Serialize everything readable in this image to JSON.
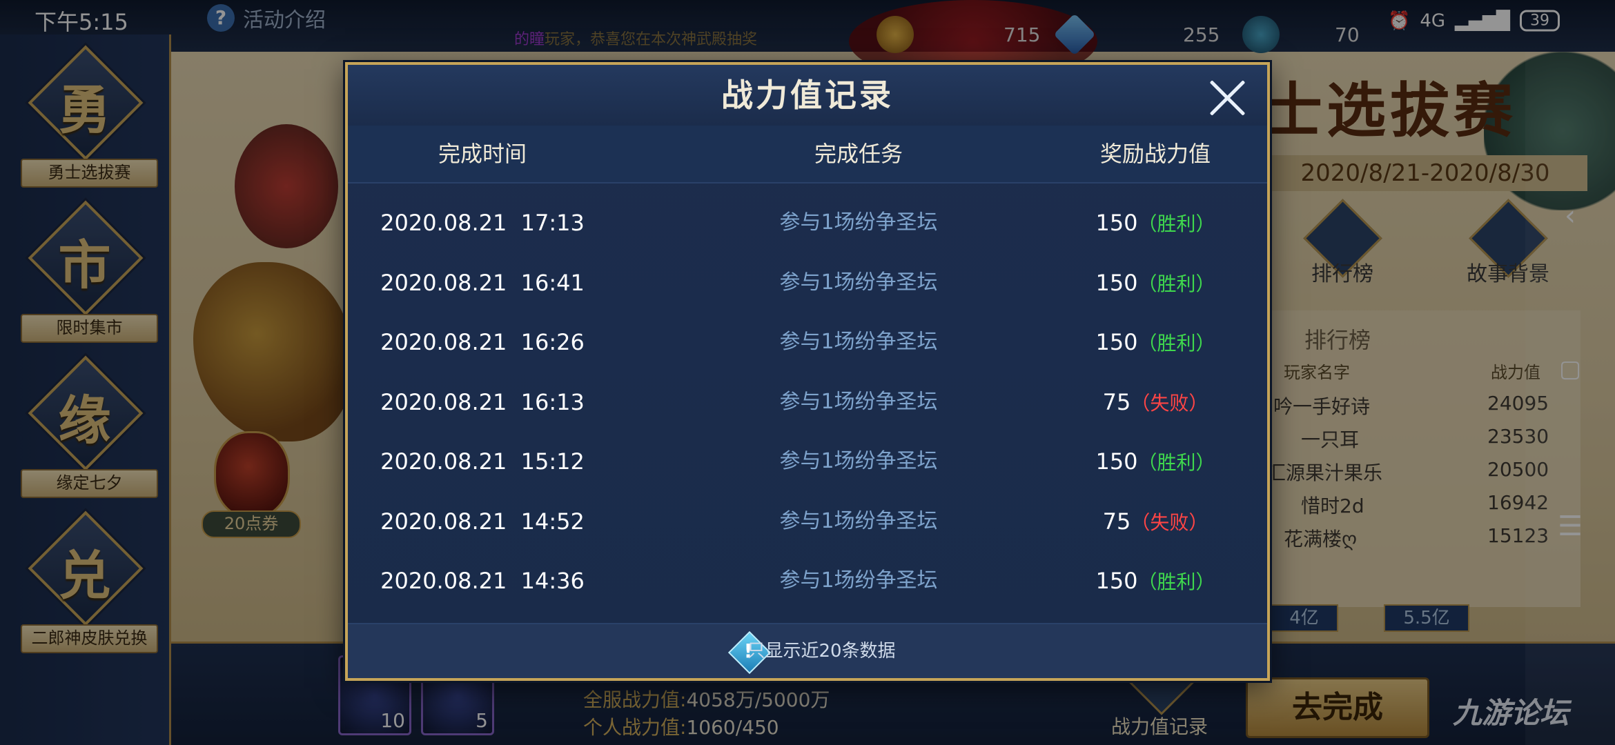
{
  "status_bar": {
    "time": "下午5:15",
    "network": "4G",
    "battery": "39"
  },
  "top_bar": {
    "activity_label": "活动介绍",
    "marquee_highlight": "的瞳",
    "marquee_text": "玩家，恭喜您在本次神武殿抽奖",
    "currencies": [
      {
        "icon": "coin-icon",
        "value": "715"
      },
      {
        "icon": "diamond-icon",
        "value": "255"
      },
      {
        "icon": "token-icon",
        "value": "70"
      }
    ]
  },
  "sidebar": {
    "items": [
      {
        "glyph": "勇",
        "label": "勇士选拔赛"
      },
      {
        "glyph": "市",
        "label": "限时集市"
      },
      {
        "glyph": "缘",
        "label": "缘定七夕"
      },
      {
        "glyph": "兑",
        "label": "二郎神皮肤兑换"
      }
    ]
  },
  "coupon": {
    "label": "20点券"
  },
  "background_panel": {
    "title": "士选拔赛",
    "date_range": "2020/8/21-2020/8/30",
    "buttons": [
      {
        "label": "排行榜"
      },
      {
        "label": "故事背景"
      }
    ],
    "ranking": {
      "title": "排行榜",
      "col_name": "玩家名字",
      "col_power": "战力值",
      "rows": [
        {
          "name": "吟一手好诗",
          "power": "24095"
        },
        {
          "name": "一只耳",
          "power": "23530"
        },
        {
          "name": "汇源果汁果乐",
          "power": "20500"
        },
        {
          "name": "惜时2d",
          "power": "16942"
        },
        {
          "name": "花满楼ღ",
          "power": "15123"
        }
      ]
    },
    "milestones": [
      "4亿",
      "5.5亿"
    ]
  },
  "bottom_bar": {
    "server_label": "全服战力值:",
    "server_value": "4058万/5000万",
    "personal_label": "个人战力值:",
    "personal_value": "1060/450",
    "skills": [
      {
        "count": "10"
      },
      {
        "count": "5"
      }
    ],
    "record_label": "战力值记录",
    "go_label": "去完成"
  },
  "watermark": "九游论坛",
  "dialog": {
    "title": "战力值记录",
    "headers": {
      "time": "完成时间",
      "task": "完成任务",
      "reward": "奖励战力值"
    },
    "rows": [
      {
        "time": "2020.08.21  17:13",
        "task": "参与1场纷争圣坛",
        "reward": "150",
        "result": "（胜利）",
        "win": true
      },
      {
        "time": "2020.08.21  16:41",
        "task": "参与1场纷争圣坛",
        "reward": "150",
        "result": "（胜利）",
        "win": true
      },
      {
        "time": "2020.08.21  16:26",
        "task": "参与1场纷争圣坛",
        "reward": "150",
        "result": "（胜利）",
        "win": true
      },
      {
        "time": "2020.08.21  16:13",
        "task": "参与1场纷争圣坛",
        "reward": "75",
        "result": "（失败）",
        "win": false
      },
      {
        "time": "2020.08.21  15:12",
        "task": "参与1场纷争圣坛",
        "reward": "150",
        "result": "（胜利）",
        "win": true
      },
      {
        "time": "2020.08.21  14:52",
        "task": "参与1场纷争圣坛",
        "reward": "75",
        "result": "（失败）",
        "win": false
      },
      {
        "time": "2020.08.21  14:36",
        "task": "参与1场纷争圣坛",
        "reward": "150",
        "result": "（胜利）",
        "win": true
      }
    ],
    "footer_note": "只显示近20条数据"
  },
  "colors": {
    "win": "#3fd84d",
    "lose": "#ff4545",
    "gold_border": "#c6a458",
    "task_text": "#7ea3cc"
  }
}
